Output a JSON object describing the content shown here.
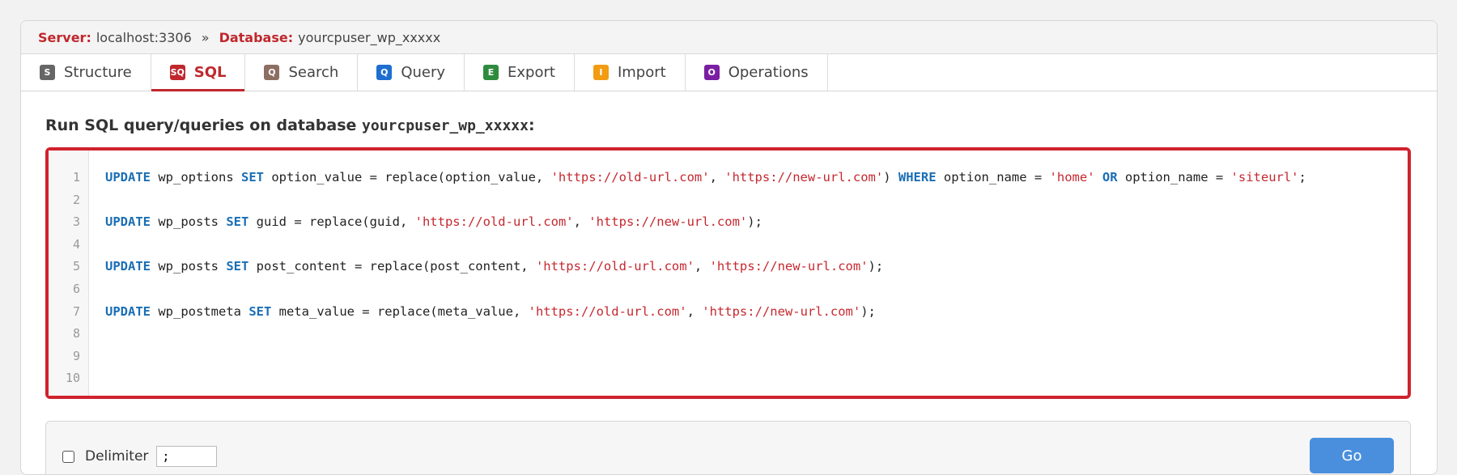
{
  "breadcrumb": {
    "server_label": "Server:",
    "server_value": "localhost:3306",
    "separator": "»",
    "database_label": "Database:",
    "database_value": "yourcpuser_wp_xxxxx"
  },
  "tabs": [
    {
      "label": "Structure",
      "icon": "structure-icon",
      "letter": "S",
      "color": "#666666",
      "active": false
    },
    {
      "label": "SQL",
      "icon": "sql-icon",
      "letter": "SQ",
      "color": "#c0282d",
      "active": true
    },
    {
      "label": "Search",
      "icon": "search-icon",
      "letter": "Q",
      "color": "#8d6e63",
      "active": false
    },
    {
      "label": "Query",
      "icon": "query-icon",
      "letter": "Q",
      "color": "#1e6fd0",
      "active": false
    },
    {
      "label": "Export",
      "icon": "export-icon",
      "letter": "E",
      "color": "#2e8b3e",
      "active": false
    },
    {
      "label": "Import",
      "icon": "import-icon",
      "letter": "I",
      "color": "#f29c11",
      "active": false
    },
    {
      "label": "Operations",
      "icon": "operations-icon",
      "letter": "O",
      "color": "#7b1fa2",
      "active": false
    }
  ],
  "main": {
    "heading": "Run SQL query/queries on database",
    "database": "yourcpuser_wp_xxxxx",
    "heading_suffix": ":"
  },
  "editor": {
    "line_numbers": [
      "1",
      "2",
      "3",
      "4",
      "5",
      "6",
      "7",
      "8",
      "9",
      "10"
    ],
    "lines": [
      [
        {
          "t": "kw",
          "v": "UPDATE"
        },
        {
          "t": "p",
          "v": " wp_options "
        },
        {
          "t": "kw",
          "v": "SET"
        },
        {
          "t": "p",
          "v": " option_value = replace(option_value, "
        },
        {
          "t": "str",
          "v": "'https://old-url.com'"
        },
        {
          "t": "p",
          "v": ", "
        },
        {
          "t": "str",
          "v": "'https://new-url.com'"
        },
        {
          "t": "p",
          "v": ") "
        },
        {
          "t": "kw",
          "v": "WHERE"
        },
        {
          "t": "p",
          "v": " option_name = "
        },
        {
          "t": "str",
          "v": "'home'"
        },
        {
          "t": "p",
          "v": " "
        },
        {
          "t": "kw",
          "v": "OR"
        },
        {
          "t": "p",
          "v": " option_name = "
        },
        {
          "t": "str",
          "v": "'siteurl'"
        },
        {
          "t": "p",
          "v": ";"
        }
      ],
      [],
      [
        {
          "t": "kw",
          "v": "UPDATE"
        },
        {
          "t": "p",
          "v": " wp_posts "
        },
        {
          "t": "kw",
          "v": "SET"
        },
        {
          "t": "p",
          "v": " guid = replace(guid, "
        },
        {
          "t": "str",
          "v": "'https://old-url.com'"
        },
        {
          "t": "p",
          "v": ", "
        },
        {
          "t": "str",
          "v": "'https://new-url.com'"
        },
        {
          "t": "p",
          "v": ");"
        }
      ],
      [],
      [
        {
          "t": "kw",
          "v": "UPDATE"
        },
        {
          "t": "p",
          "v": " wp_posts "
        },
        {
          "t": "kw",
          "v": "SET"
        },
        {
          "t": "p",
          "v": " post_content = replace(post_content, "
        },
        {
          "t": "str",
          "v": "'https://old-url.com'"
        },
        {
          "t": "p",
          "v": ", "
        },
        {
          "t": "str",
          "v": "'https://new-url.com'"
        },
        {
          "t": "p",
          "v": ");"
        }
      ],
      [],
      [
        {
          "t": "kw",
          "v": "UPDATE"
        },
        {
          "t": "p",
          "v": " wp_postmeta "
        },
        {
          "t": "kw",
          "v": "SET"
        },
        {
          "t": "p",
          "v": " meta_value = replace(meta_value, "
        },
        {
          "t": "str",
          "v": "'https://old-url.com'"
        },
        {
          "t": "p",
          "v": ", "
        },
        {
          "t": "str",
          "v": "'https://new-url.com'"
        },
        {
          "t": "p",
          "v": ");"
        }
      ],
      [],
      [],
      []
    ]
  },
  "options": {
    "delimiter_label": "Delimiter",
    "delimiter_value": ";",
    "delimiter_checked": false,
    "go_label": "Go"
  },
  "colors": {
    "accent": "#c0282d",
    "keyword": "#1a6eb5",
    "string": "#c5282f",
    "go_button": "#4a8fdd"
  }
}
